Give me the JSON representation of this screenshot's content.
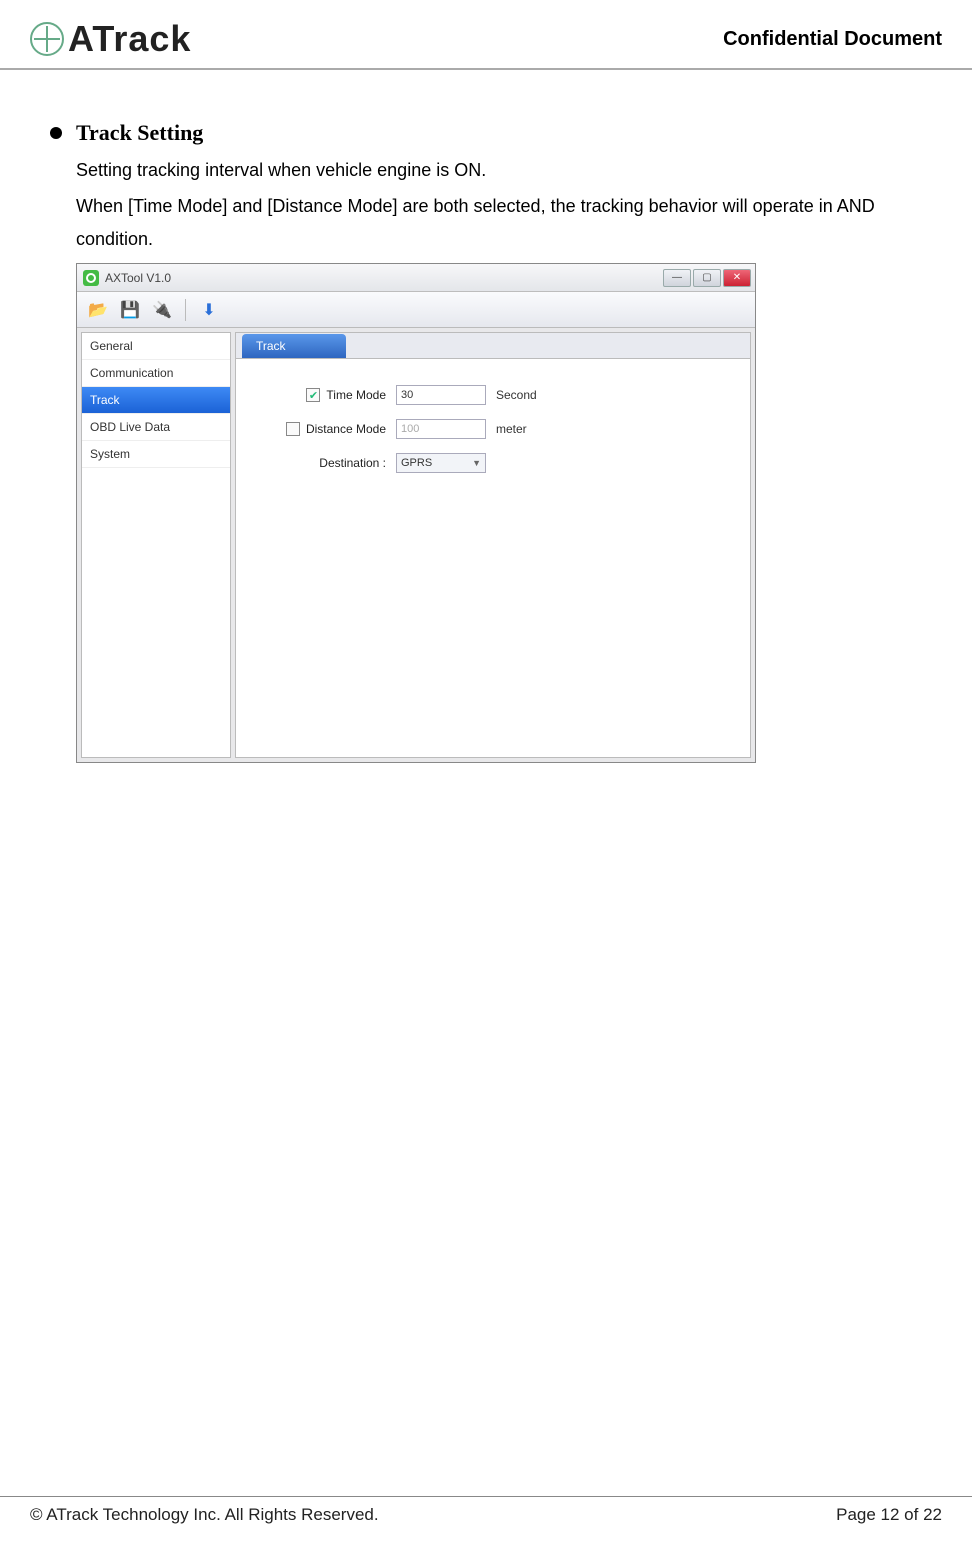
{
  "header": {
    "logo_text": "ATrack",
    "confidential": "Confidential  Document"
  },
  "section": {
    "title": "Track Setting",
    "desc1": "Setting tracking interval when vehicle engine is ON.",
    "desc2": "When [Time Mode] and [Distance Mode] are both selected, the tracking behavior will operate in AND condition."
  },
  "app": {
    "title": "AXTool V1.0",
    "window_buttons": {
      "min": "—",
      "max": "▢",
      "close": "✕"
    },
    "toolbar": {
      "open_tip": "📂",
      "save_tip": "💾",
      "device_tip": "🔌",
      "down_tip": "⬇"
    },
    "sidebar": {
      "items": [
        "General",
        "Communication",
        "Track",
        "OBD Live Data",
        "System"
      ],
      "selected_index": 2
    },
    "tab": {
      "label": "Track"
    },
    "form": {
      "time_mode": {
        "label": "Time Mode",
        "checked": true,
        "value": "30",
        "unit": "Second"
      },
      "distance_mode": {
        "label": "Distance Mode",
        "checked": false,
        "value": "100",
        "unit": "meter"
      },
      "destination": {
        "label": "Destination :",
        "value": "GPRS"
      }
    }
  },
  "footer": {
    "left": "© ATrack Technology Inc. All Rights Reserved.",
    "right": "Page 12 of 22"
  }
}
